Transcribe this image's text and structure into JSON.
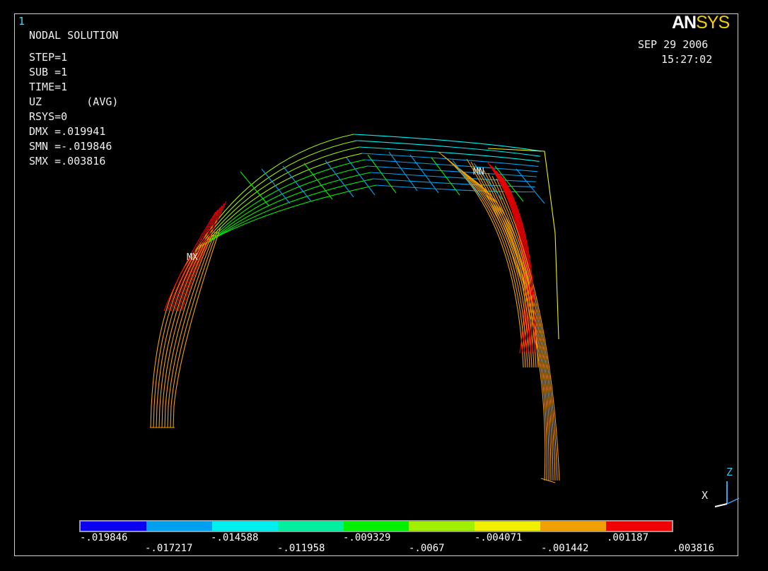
{
  "window_number": "1",
  "logo": {
    "part1": "AN",
    "part2": "SYS"
  },
  "date": "SEP 29 2006",
  "time": "15:27:02",
  "info": {
    "title": "NODAL SOLUTION",
    "step": "STEP=1",
    "sub": "SUB =1",
    "time_line": "TIME=1",
    "component": "UZ       (AVG)",
    "rsys": "RSYS=0",
    "dmx": "DMX =.019941",
    "smn": "SMN =-.019846",
    "smx": "SMX =.003816"
  },
  "markers": {
    "mx": "MX",
    "mn": "MN"
  },
  "triad": {
    "x": "X",
    "z": "Z"
  },
  "legend": {
    "colors": [
      "#0c00f0",
      "#00a0f0",
      "#00f0f0",
      "#00f0a0",
      "#00f000",
      "#a0f000",
      "#f0f000",
      "#f0a000",
      "#f00000"
    ],
    "labels_bottom_row": [
      "-.019846",
      "-.014588",
      "-.009329",
      "-.004071",
      ".001187"
    ],
    "labels_top_row": [
      "-.017217",
      "-.011958",
      "-.0067",
      "-.001442",
      ".003816"
    ]
  }
}
